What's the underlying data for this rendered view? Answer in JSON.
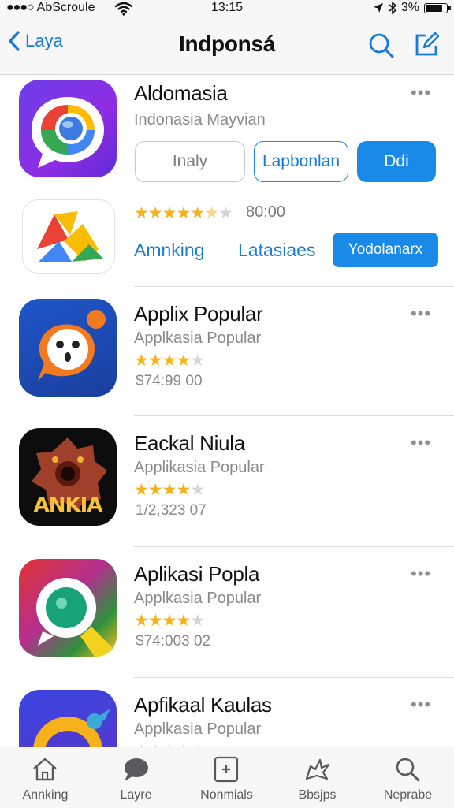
{
  "status_bar": {
    "carrier": "AbScroule",
    "time": "13:15",
    "battery": "3%",
    "battery_level": 0.85
  },
  "nav": {
    "back_label": "Laya",
    "title": "Indponsá"
  },
  "featured": {
    "name": "Aldomasia",
    "subtitle": "Indonasia Mayvian",
    "buttons": [
      "Inaly",
      "Lapbonlan",
      "Ddi"
    ],
    "rating_text": "80:00",
    "rating": 4.5,
    "links": [
      "Amnking",
      "Latasiaes"
    ],
    "action_button": "Yodolanarx"
  },
  "apps": [
    {
      "name": "Applix Popular",
      "subtitle": "Applkasia Popular",
      "rating": 4,
      "price": "$74:99 00"
    },
    {
      "name": "Eackal Niula",
      "subtitle": "Applikasia Popular",
      "rating": 4,
      "price": "1/2,323 07",
      "icon_text": "ANKIA"
    },
    {
      "name": "Aplikasi Popla",
      "subtitle": "Applkasia Popular",
      "rating": 4,
      "price": "$74:003 02"
    },
    {
      "name": "Apfikaal Kaulas",
      "subtitle": "Applkasia Popular",
      "rating": 4
    }
  ],
  "tabs": [
    {
      "label": "Annking",
      "icon": "home-icon"
    },
    {
      "label": "Layre",
      "icon": "chat-bubble-icon"
    },
    {
      "label": "Nonmials",
      "icon": "calculator-icon"
    },
    {
      "label": "Bbsjps",
      "icon": "star-burst-icon"
    },
    {
      "label": "Neprabe",
      "icon": "search-icon"
    }
  ],
  "colors": {
    "accent": "#1a8ae8",
    "star": "#f5b21b",
    "secondary_text": "#8a8a8e"
  }
}
